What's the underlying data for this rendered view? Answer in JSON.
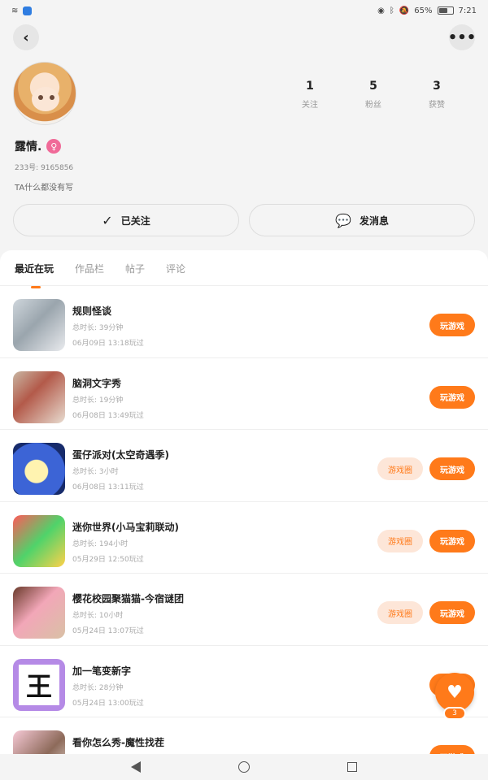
{
  "status_bar": {
    "battery": "65%",
    "battery_level": 0.65,
    "time": "7:21"
  },
  "profile": {
    "nickname": "露情.",
    "gender_symbol": "♀",
    "user_id": "233号: 9165856",
    "bio": "TA什么都没有写",
    "stats": [
      {
        "num": "1",
        "label": "关注"
      },
      {
        "num": "5",
        "label": "粉丝"
      },
      {
        "num": "3",
        "label": "获赞"
      }
    ]
  },
  "actions": {
    "followed_label": "已关注",
    "message_label": "发消息",
    "check_icon": "✓",
    "chat_icon": "💬"
  },
  "tabs": [
    {
      "label": "最近在玩"
    },
    {
      "label": "作品栏"
    },
    {
      "label": "帖子"
    },
    {
      "label": "评论"
    }
  ],
  "games": [
    {
      "title": "规则怪谈",
      "duration": "总时长: 39分钟",
      "last_played": "06月09日 13:18玩过",
      "play_label": "玩游戏"
    },
    {
      "title": "脑洞文字秀",
      "duration": "总时长: 19分钟",
      "last_played": "06月08日 13:49玩过",
      "play_label": "玩游戏"
    },
    {
      "title": "蛋仔派对(太空奇遇季)",
      "duration": "总时长: 3小时",
      "last_played": "06月08日 13:11玩过",
      "play_label": "玩游戏",
      "circle_label": "游戏圈"
    },
    {
      "title": "迷你世界(小马宝莉联动)",
      "duration": "总时长: 194小时",
      "last_played": "05月29日 12:50玩过",
      "play_label": "玩游戏",
      "circle_label": "游戏圈"
    },
    {
      "title": "樱花校园聚猫猫-今宿谜团",
      "duration": "总时长: 10小时",
      "last_played": "05月24日 13:07玩过",
      "play_label": "玩游戏",
      "circle_label": "游戏圈"
    },
    {
      "title": "加一笔变新字",
      "duration": "总时长: 28分钟",
      "last_played": "05月24日 13:00玩过",
      "play_label": "玩游戏",
      "thumb_char": "王"
    },
    {
      "title": "看你怎么秀-魔性找茬",
      "duration": "",
      "last_played": "",
      "play_label": "玩游戏"
    }
  ],
  "fab": {
    "icon": "♥",
    "count": "3"
  },
  "colors": {
    "accent": "#ff7a1a",
    "accent_light": "#fde6d8",
    "gender_pink": "#f06a98"
  }
}
